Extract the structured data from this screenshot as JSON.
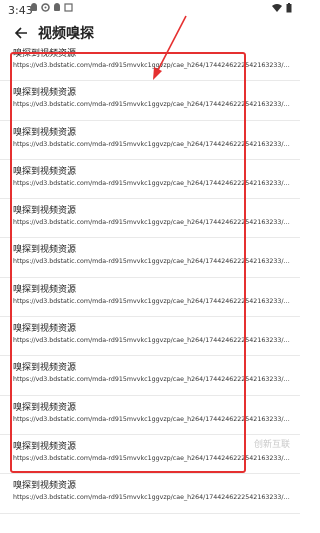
{
  "status": {
    "time": "3:43",
    "icons": [
      "android-icon",
      "gear-icon",
      "android-icon",
      "screen-record-icon",
      "wifi-icon",
      "battery-icon"
    ]
  },
  "header": {
    "back_icon": "arrow-left-icon",
    "title": "视频嗅探"
  },
  "list": {
    "items": [
      {
        "title": "嗅探到视频资源",
        "url": "https://vd3.bdstatic.com/mda-rd915mvvkc1ggvzp/cae_h264/1744246222542163233/mda-rd915mvvkc1ggvzp.mp4"
      },
      {
        "title": "嗅探到视频资源",
        "url": "https://vd3.bdstatic.com/mda-rd915mvvkc1ggvzp/cae_h264/1744246222542163233/mda-rd915mvvkc1ggvzp.mp4"
      },
      {
        "title": "嗅探到视频资源",
        "url": "https://vd3.bdstatic.com/mda-rd915mvvkc1ggvzp/cae_h264/1744246222542163233/mda-rd915mvvkc1ggvzp.mp4"
      },
      {
        "title": "嗅探到视频资源",
        "url": "https://vd3.bdstatic.com/mda-rd915mvvkc1ggvzp/cae_h264/1744246222542163233/mda-rd915mvvkc1ggvzp.mp4"
      },
      {
        "title": "嗅探到视频资源",
        "url": "https://vd3.bdstatic.com/mda-rd915mvvkc1ggvzp/cae_h264/1744246222542163233/mda-rd915mvvkc1ggvzp.mp4"
      },
      {
        "title": "嗅探到视频资源",
        "url": "https://vd3.bdstatic.com/mda-rd915mvvkc1ggvzp/cae_h264/1744246222542163233/mda-rd915mvvkc1ggvzp.mp4"
      },
      {
        "title": "嗅探到视频资源",
        "url": "https://vd3.bdstatic.com/mda-rd915mvvkc1ggvzp/cae_h264/1744246222542163233/mda-rd915mvvkc1ggvzp.mp4"
      },
      {
        "title": "嗅探到视频资源",
        "url": "https://vd3.bdstatic.com/mda-rd915mvvkc1ggvzp/cae_h264/1744246222542163233/mda-rd915mvvkc1ggvzp.mp4"
      },
      {
        "title": "嗅探到视频资源",
        "url": "https://vd3.bdstatic.com/mda-rd915mvvkc1ggvzp/cae_h264/1744246222542163233/mda-rd915mvvkc1ggvzp.mp4"
      },
      {
        "title": "嗅探到视频资源",
        "url": "https://vd3.bdstatic.com/mda-rd915mvvkc1ggvzp/cae_h264/1744246222542163233/mda-rd915mvvkc1ggvzp.mp4"
      },
      {
        "title": "嗅探到视频资源",
        "url": "https://vd3.bdstatic.com/mda-rd915mvvkc1ggvzp/cae_h264/1744246222542163233/mda-rd915mvvkc1ggvzp.mp4"
      },
      {
        "title": "嗅探到视频资源",
        "url": "https://vd3.bdstatic.com/mda-rd915mvvkc1ggvzp/cae_h264/1744246222542163233/mda-rd915mvvkc1ggvzp.mp4"
      }
    ]
  },
  "annotation": {
    "color": "#e53030"
  },
  "watermark": "创新互联"
}
